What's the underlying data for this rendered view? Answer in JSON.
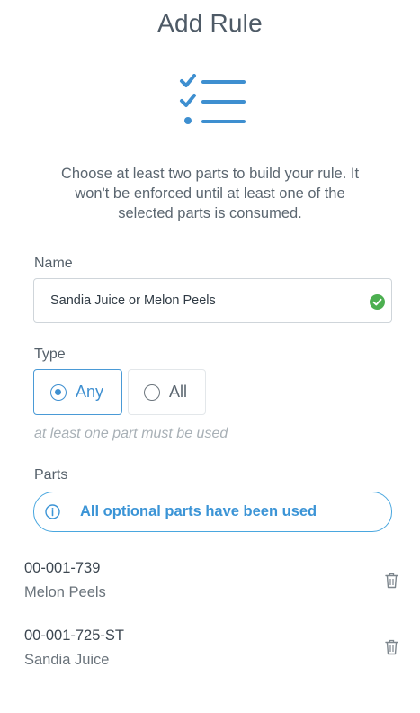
{
  "header": {
    "title": "Add Rule"
  },
  "hero_icon": "checklist-icon",
  "intro": {
    "text": "Choose at least two parts to build your rule. It won't be enforced until at least one of the selected parts is consumed."
  },
  "name_field": {
    "label": "Name",
    "value": "Sandia Juice or Melon Peels",
    "status_icon": "check-circle-icon",
    "status_color": "#4caf50"
  },
  "type_field": {
    "label": "Type",
    "options": [
      {
        "label": "Any",
        "selected": true
      },
      {
        "label": "All",
        "selected": false
      }
    ],
    "hint": "at least one part must be used"
  },
  "parts": {
    "label": "Parts",
    "banner_text": "All optional parts have been used",
    "items": [
      {
        "number": "00-001-739",
        "name": "Melon Peels"
      },
      {
        "number": "00-001-725-ST",
        "name": "Sandia Juice"
      }
    ]
  },
  "colors": {
    "accent": "#3e8fd0",
    "banner_border": "#4aa7df",
    "success": "#4caf50"
  }
}
